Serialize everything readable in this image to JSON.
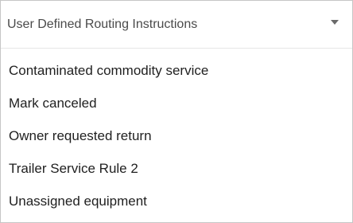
{
  "dropdown": {
    "label": "User Defined Routing Instructions",
    "chevron_icon": "chevron-down-icon",
    "options": [
      "Contaminated commodity service",
      "Mark canceled",
      "Owner requested return",
      "Trailer Service Rule 2",
      "Unassigned equipment"
    ]
  }
}
